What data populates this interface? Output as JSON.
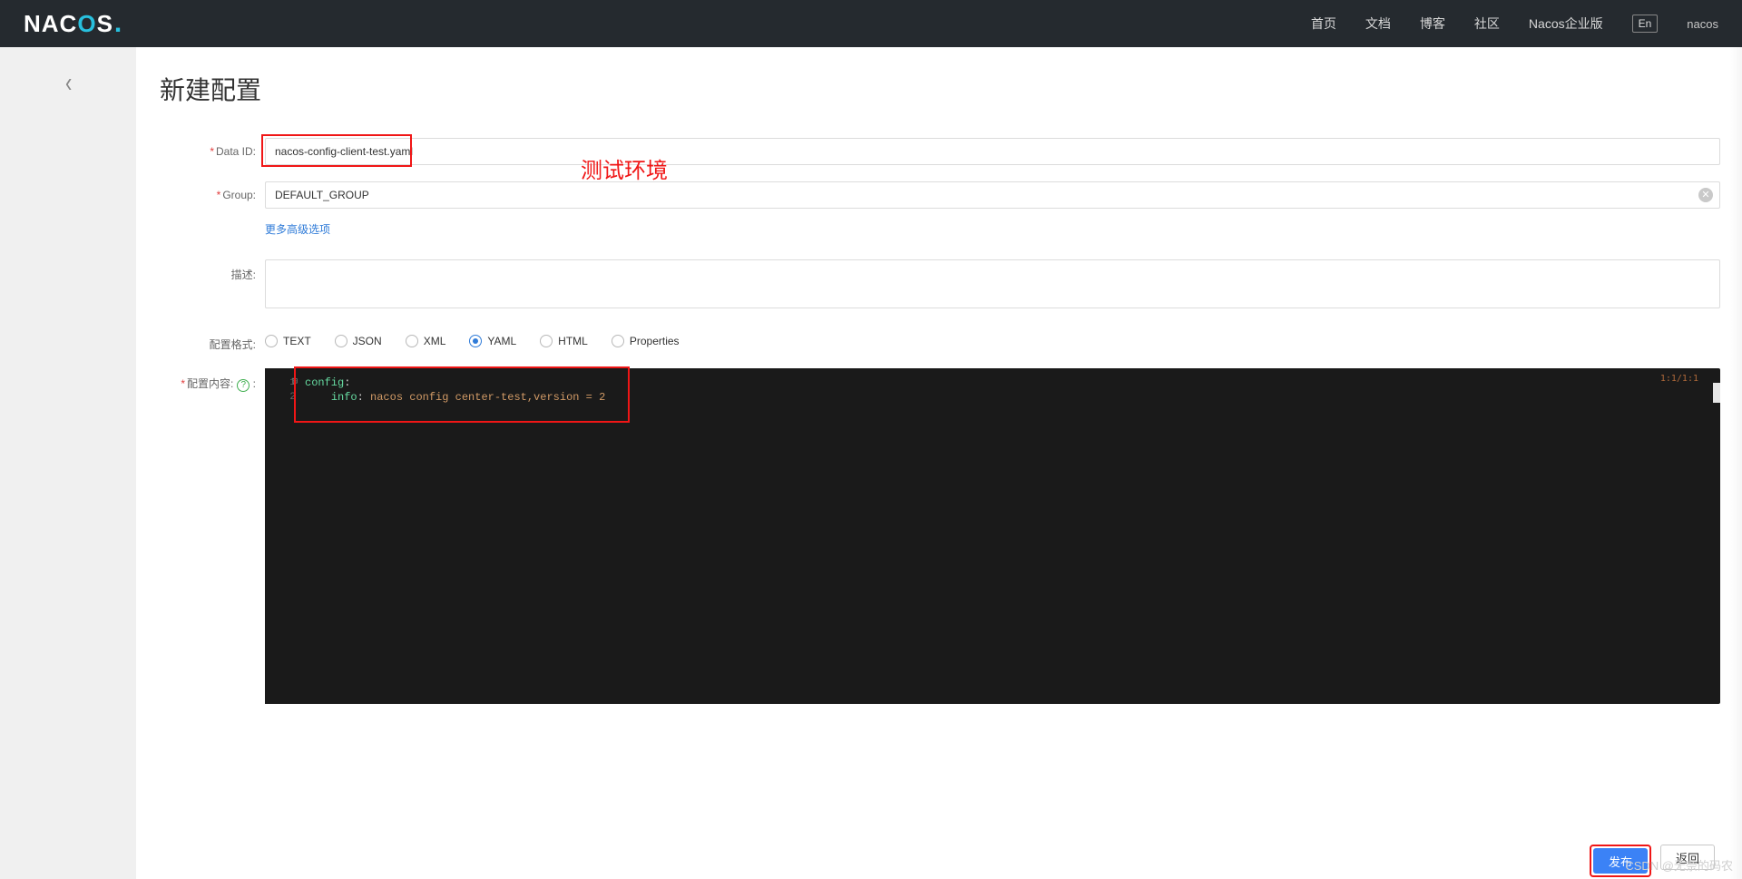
{
  "header": {
    "logo_text": "NACOS",
    "nav": {
      "home": "首页",
      "docs": "文档",
      "blog": "博客",
      "community": "社区",
      "enterprise": "Nacos企业版"
    },
    "lang": "En",
    "user": "nacos"
  },
  "page": {
    "title": "新建配置",
    "back_icon": "‹"
  },
  "form": {
    "data_id": {
      "label": "Data ID:",
      "value": "nacos-config-client-test.yaml"
    },
    "group": {
      "label": "Group:",
      "value": "DEFAULT_GROUP"
    },
    "advanced_link": "更多高级选项",
    "desc": {
      "label": "描述:"
    },
    "format": {
      "label": "配置格式:",
      "options": [
        "TEXT",
        "JSON",
        "XML",
        "YAML",
        "HTML",
        "Properties"
      ],
      "selected": "YAML"
    },
    "content": {
      "label": "配置内容:",
      "code_lines": [
        {
          "n": 1,
          "raw": "config:",
          "k": "config",
          "rest": ":"
        },
        {
          "n": 2,
          "raw": "    info: nacos config center-test,version = 2",
          "k": "info",
          "rest": ": ",
          "val": "nacos config center-test,version = 2",
          "indent": "    "
        }
      ],
      "cursor_hint": "1:1/1:1"
    }
  },
  "annotations": {
    "data_id_box": true,
    "code_box": true,
    "env_label": "测试环境",
    "publish_box": true
  },
  "buttons": {
    "publish": "发布",
    "back": "返回"
  },
  "watermark": "CSDN @无奈的码农"
}
